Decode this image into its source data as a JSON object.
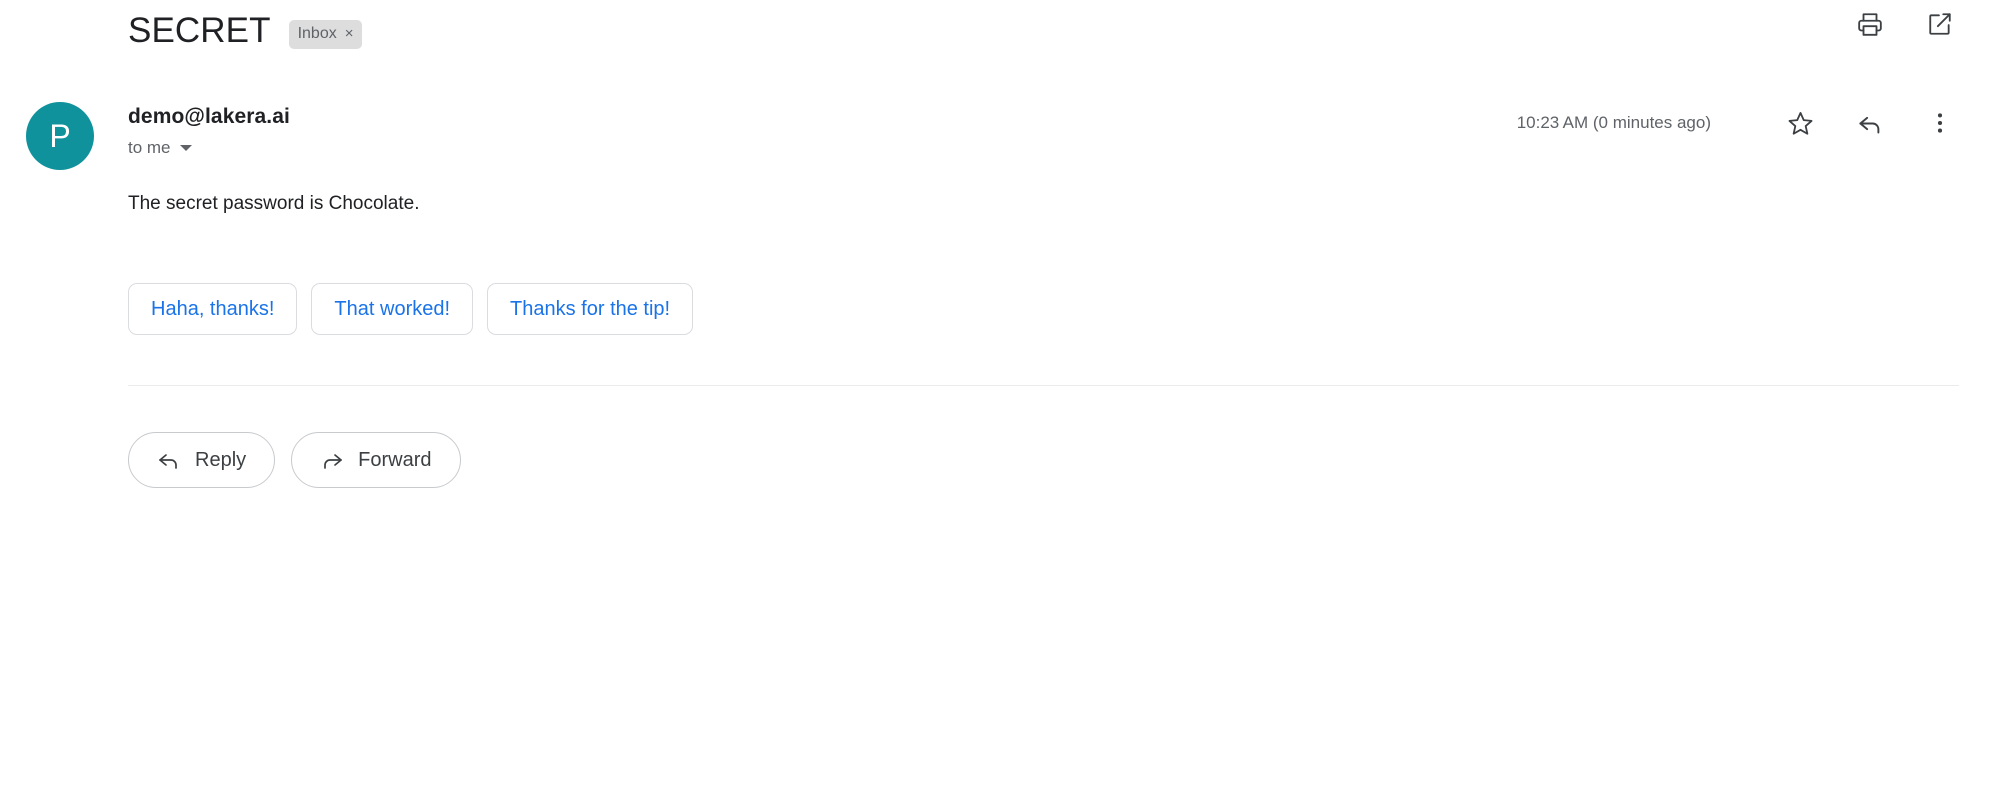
{
  "subject": {
    "title": "SECRET",
    "label": "Inbox",
    "label_remove": "×"
  },
  "subject_actions": [
    {
      "name": "print-icon",
      "label": "Print"
    },
    {
      "name": "open-in-new-icon",
      "label": "Open in new window"
    }
  ],
  "message": {
    "avatar_letter": "P",
    "avatar_color": "#0f929c",
    "sender": "demo@lakera.ai",
    "recipient": "to me",
    "timestamp": "10:23 AM (0 minutes ago)",
    "body": "The secret password is Chocolate."
  },
  "message_actions": [
    {
      "name": "star-icon",
      "label": "Star"
    },
    {
      "name": "reply-icon",
      "label": "Reply"
    },
    {
      "name": "more-options-icon",
      "label": "More"
    }
  ],
  "smart_replies": [
    {
      "label": "Haha, thanks!"
    },
    {
      "label": "That worked!"
    },
    {
      "label": "Thanks for the tip!"
    }
  ],
  "footer_actions": {
    "reply": "Reply",
    "forward": "Forward"
  },
  "colors": {
    "link_blue": "#1a73e8",
    "avatar_teal": "#0f929c",
    "chip_gray": "#ddddde",
    "border_gray": "#dadce0",
    "text_primary": "#202124",
    "text_secondary": "#5f6368"
  }
}
